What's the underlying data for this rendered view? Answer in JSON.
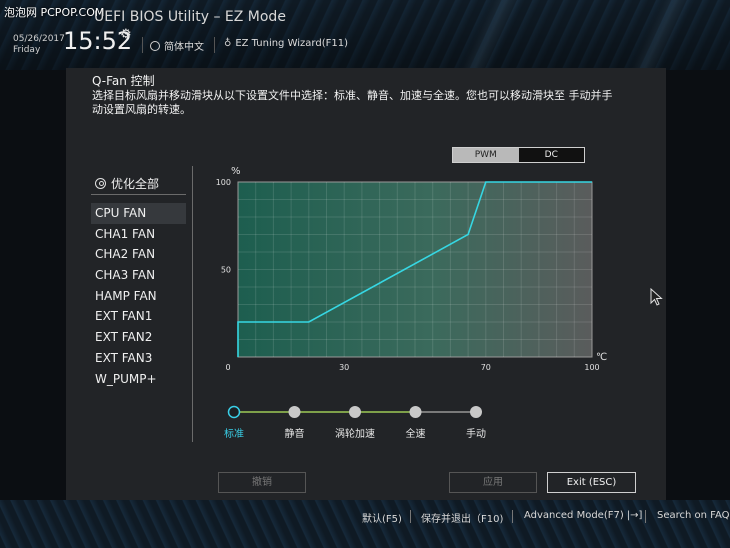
{
  "watermark": "泡泡网 PCPOP.COM",
  "header": {
    "title": "UEFI BIOS Utility – EZ Mode",
    "date": "05/26/2017",
    "day": "Friday",
    "time": "15:52",
    "language": "简体中文",
    "wizard": "EZ Tuning Wizard(F11)"
  },
  "qfan": {
    "title": "Q-Fan 控制",
    "description": "选择目标风扇并移动滑块从以下设置文件中选择：标准、静音、加速与全速。您也可以移动滑块至 手动并手动设置风扇的转速。",
    "mode_pwm": "PWM",
    "mode_dc": "DC",
    "optimize_all": "优化全部",
    "fans": [
      "CPU FAN",
      "CHA1 FAN",
      "CHA2 FAN",
      "CHA3 FAN",
      "HAMP FAN",
      "EXT FAN1",
      "EXT FAN2",
      "EXT FAN3",
      "W_PUMP+"
    ],
    "active_fan": "CPU FAN",
    "profiles": [
      "标准",
      "静音",
      "涡轮加速",
      "全速",
      "手动"
    ],
    "selected_profile": "标准"
  },
  "chart_data": {
    "type": "line",
    "ylabel": "%",
    "xlabel": "℃",
    "xlim": [
      0,
      100
    ],
    "ylim": [
      0,
      100
    ],
    "x_ticks": [
      "0",
      "30",
      "70",
      "100"
    ],
    "y_ticks": [
      "100",
      "50"
    ],
    "grid": true,
    "series": [
      {
        "x": [
          0,
          0,
          20,
          65,
          70,
          100
        ],
        "y": [
          0,
          20,
          20,
          70,
          100,
          100
        ]
      }
    ],
    "line_color": "#36d7e3"
  },
  "buttons": {
    "undo": "撤销",
    "apply": "应用",
    "exit": "Exit (ESC)"
  },
  "footer": {
    "default": "默认(F5)",
    "save_exit": "保存并退出（F10)",
    "advanced": "Advanced Mode(F7)",
    "search": "Search on FAQ"
  }
}
